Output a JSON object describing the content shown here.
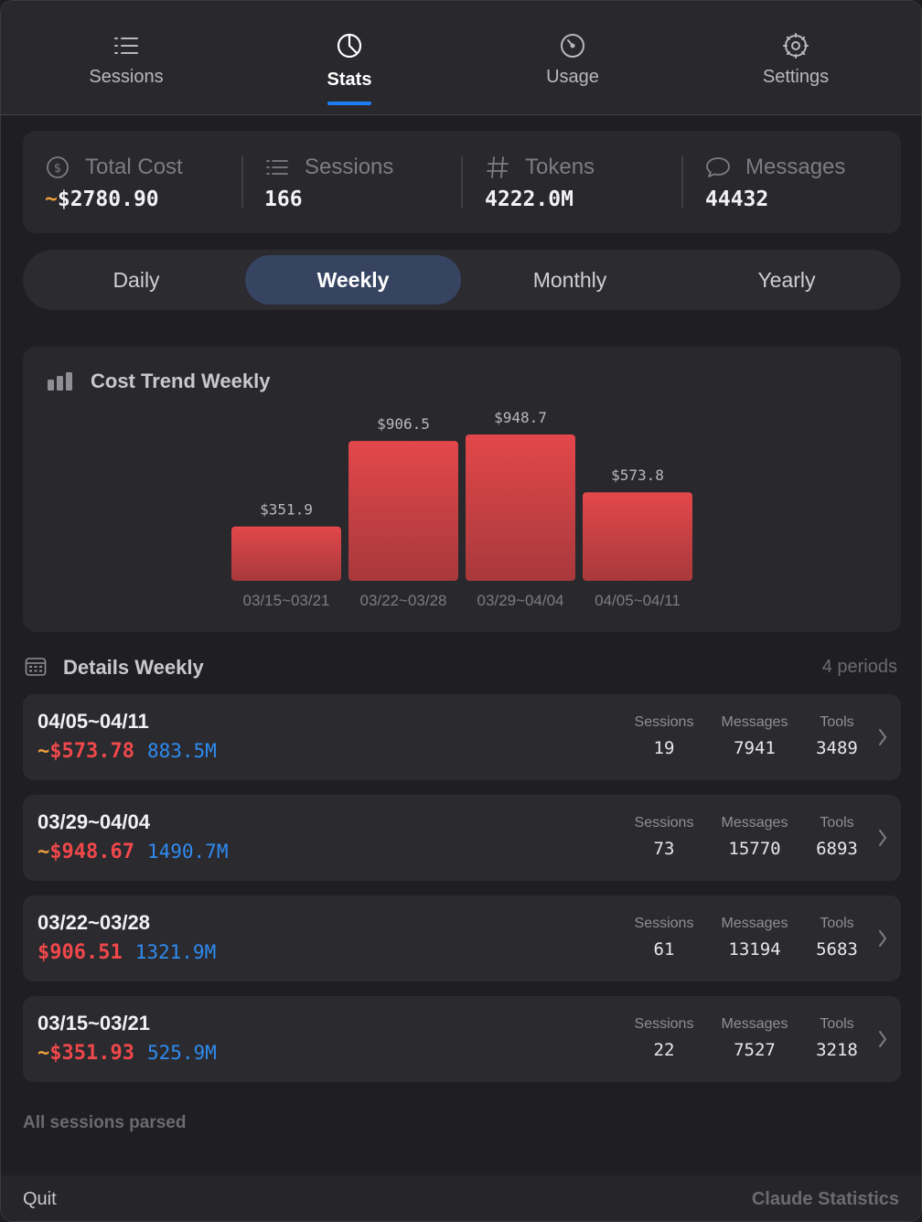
{
  "nav": {
    "tabs": [
      {
        "label": "Sessions",
        "icon": "list-icon"
      },
      {
        "label": "Stats",
        "icon": "pie-chart-icon",
        "active": true
      },
      {
        "label": "Usage",
        "icon": "gauge-icon"
      },
      {
        "label": "Settings",
        "icon": "gear-icon"
      }
    ]
  },
  "summary": {
    "total_cost": {
      "label": "Total Cost",
      "prefix": "~",
      "value": "$2780.90",
      "icon": "dollar-circle-icon"
    },
    "sessions": {
      "label": "Sessions",
      "value": "166",
      "icon": "list-icon"
    },
    "tokens": {
      "label": "Tokens",
      "value": "4222.0M",
      "icon": "hash-icon"
    },
    "messages": {
      "label": "Messages",
      "value": "44432",
      "icon": "speech-bubble-icon"
    }
  },
  "periods": {
    "options": [
      "Daily",
      "Weekly",
      "Monthly",
      "Yearly"
    ],
    "selected": "Weekly"
  },
  "chart": {
    "title": "Cost Trend Weekly",
    "icon": "bar-chart-icon"
  },
  "chart_data": {
    "type": "bar",
    "title": "Cost Trend Weekly",
    "categories": [
      "03/15~03/21",
      "03/22~03/28",
      "03/29~04/04",
      "04/05~04/11"
    ],
    "values": [
      351.9,
      906.5,
      948.7,
      573.8
    ],
    "value_labels": [
      "$351.9",
      "$906.5",
      "$948.7",
      "$573.8"
    ],
    "xlabel": "",
    "ylabel": "",
    "ylim": [
      0,
      948.7
    ],
    "grid": false,
    "bar_color_top": "#e3474a",
    "bar_color_bottom": "#a8393c"
  },
  "details": {
    "title": "Details Weekly",
    "count_label": "4 periods",
    "icon": "calendar-icon",
    "metric_labels": {
      "sessions": "Sessions",
      "messages": "Messages",
      "tools": "Tools"
    },
    "rows": [
      {
        "period": "04/05~04/11",
        "approx": "~",
        "cost": "$573.78",
        "tokens": "883.5M",
        "sessions": "19",
        "messages": "7941",
        "tools": "3489"
      },
      {
        "period": "03/29~04/04",
        "approx": "~",
        "cost": "$948.67",
        "tokens": "1490.7M",
        "sessions": "73",
        "messages": "15770",
        "tools": "6893"
      },
      {
        "period": "03/22~03/28",
        "approx": "",
        "cost": "$906.51",
        "tokens": "1321.9M",
        "sessions": "61",
        "messages": "13194",
        "tools": "5683"
      },
      {
        "period": "03/15~03/21",
        "approx": "~",
        "cost": "$351.93",
        "tokens": "525.9M",
        "sessions": "22",
        "messages": "7527",
        "tools": "3218"
      }
    ]
  },
  "status": "All sessions parsed",
  "footer": {
    "quit_label": "Quit",
    "app_name": "Claude Statistics"
  },
  "colors": {
    "accent": "#1e7df4",
    "cost_red": "#f0484a",
    "tokens_blue": "#2f8bf0",
    "approx_orange": "#f0a03c"
  }
}
